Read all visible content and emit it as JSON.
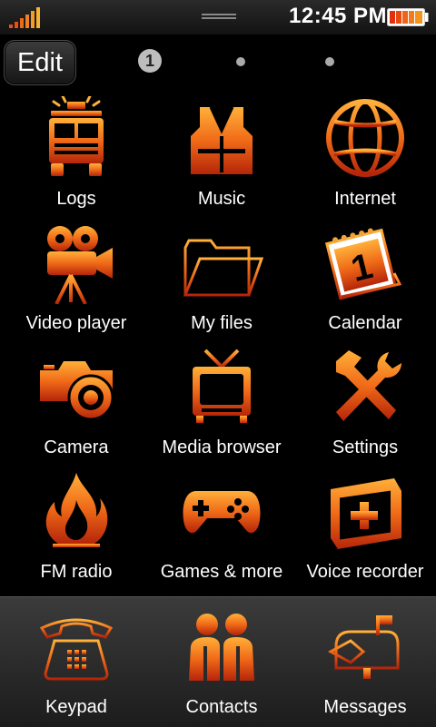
{
  "status_bar": {
    "time": "12:45 PM",
    "signal_icon": "signal-strength-icon",
    "battery_icon": "battery-icon",
    "handle_icon": "notification-drag-handle-icon"
  },
  "toolbar": {
    "edit_label": "Edit"
  },
  "pagination": {
    "current_page": "1",
    "total_pages": 3
  },
  "apps": [
    {
      "label": "Logs",
      "icon": "fire-truck-icon"
    },
    {
      "label": "Music",
      "icon": "life-vest-icon"
    },
    {
      "label": "Internet",
      "icon": "globe-icon"
    },
    {
      "label": "Video player",
      "icon": "film-camera-icon"
    },
    {
      "label": "My files",
      "icon": "folder-icon"
    },
    {
      "label": "Calendar",
      "icon": "calendar-icon"
    },
    {
      "label": "Camera",
      "icon": "camera-icon"
    },
    {
      "label": "Media browser",
      "icon": "tv-icon"
    },
    {
      "label": "Settings",
      "icon": "tools-icon"
    },
    {
      "label": "FM radio",
      "icon": "flame-icon"
    },
    {
      "label": "Games & more",
      "icon": "gamepad-icon"
    },
    {
      "label": "Voice recorder",
      "icon": "first-aid-kit-icon"
    }
  ],
  "dock": [
    {
      "label": "Keypad",
      "icon": "telephone-icon"
    },
    {
      "label": "Contacts",
      "icon": "people-icon"
    },
    {
      "label": "Messages",
      "icon": "mailbox-icon"
    }
  ],
  "colors": {
    "accent": "#f07a1e",
    "accent_dark": "#c0310c",
    "background": "#000000"
  }
}
